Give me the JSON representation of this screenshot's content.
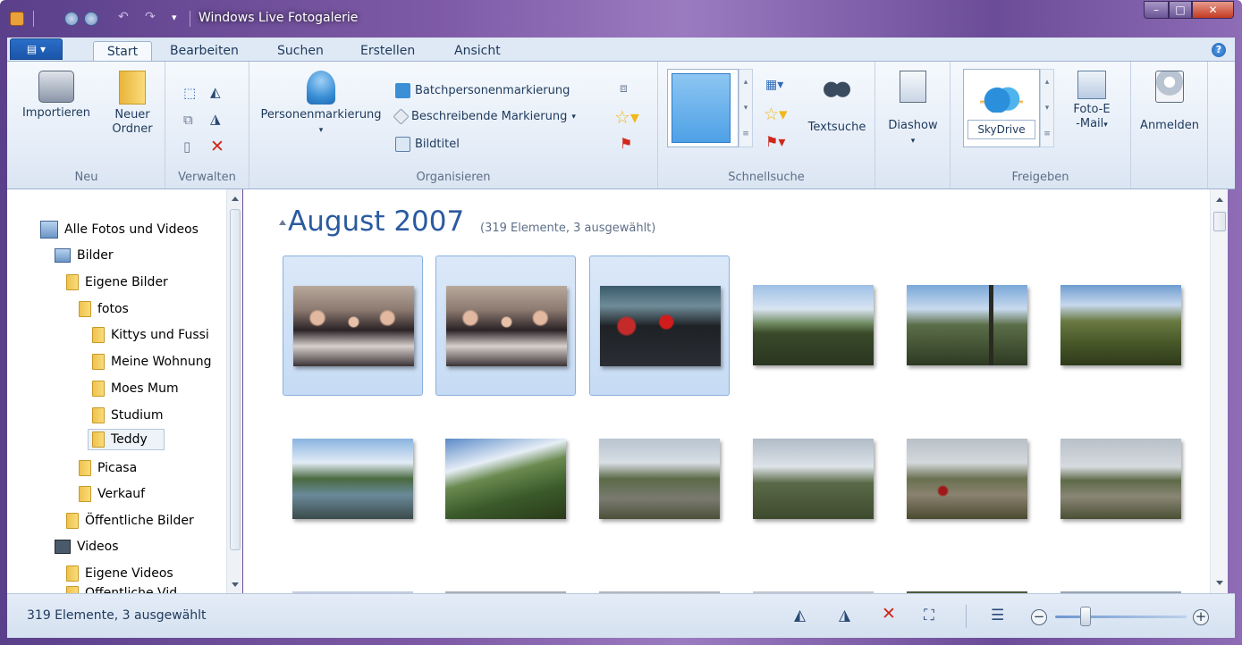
{
  "window": {
    "title": "Windows Live Fotogalerie",
    "min": "–",
    "max": "□",
    "close": "✕"
  },
  "ribbon": {
    "tabs": [
      "Start",
      "Bearbeiten",
      "Suchen",
      "Erstellen",
      "Ansicht"
    ],
    "help": "?",
    "groups": {
      "neu": {
        "label": "Neu",
        "importieren": "Importieren",
        "neuer_ordner_1": "Neuer",
        "neuer_ordner_2": "Ordner"
      },
      "verwalten": {
        "label": "Verwalten"
      },
      "organisieren": {
        "label": "Organisieren",
        "personen": "Personenmarkierung",
        "batch": "Batchpersonenmarkierung",
        "beschreibend": "Beschreibende Markierung",
        "bildtitel": "Bildtitel"
      },
      "schnellsuche": {
        "label": "Schnellsuche",
        "textsuche": "Textsuche"
      },
      "diashow": {
        "label": "Diashow"
      },
      "freigeben": {
        "label": "Freigeben",
        "skydrive": "SkyDrive",
        "foto_email_1": "Foto-E",
        "foto_email_2": "-Mail"
      },
      "anmelden": {
        "label": "Anmelden"
      }
    }
  },
  "nav": {
    "items": [
      {
        "label": "Alle Fotos und Videos",
        "type": "gallery"
      },
      {
        "label": "Bilder",
        "type": "pictures"
      },
      {
        "label": "Eigene Bilder",
        "type": "folder"
      },
      {
        "label": "fotos",
        "type": "folder"
      },
      {
        "label": "Kittys und Fussi",
        "type": "folder"
      },
      {
        "label": "Meine Wohnung",
        "type": "folder"
      },
      {
        "label": "Moes Mum",
        "type": "folder"
      },
      {
        "label": "Studium",
        "type": "folder"
      },
      {
        "label": "Teddy",
        "type": "folder",
        "selected": true
      },
      {
        "label": "Picasa",
        "type": "folder"
      },
      {
        "label": "Verkauf",
        "type": "folder"
      },
      {
        "label": "Öffentliche Bilder",
        "type": "folder"
      },
      {
        "label": "Videos",
        "type": "videos"
      },
      {
        "label": "Eigene Videos",
        "type": "folder"
      },
      {
        "label": "Öffentliche Vid",
        "type": "folder"
      }
    ]
  },
  "main": {
    "heading": "August 2007",
    "subheading": "(319 Elemente, 3 ausgewählt)",
    "photos": [
      {
        "kind": "people",
        "selected": true
      },
      {
        "kind": "people",
        "selected": true
      },
      {
        "kind": "people",
        "selected": true
      },
      {
        "kind": "landscape",
        "selected": false
      },
      {
        "kind": "landscape",
        "selected": false
      },
      {
        "kind": "landscape",
        "selected": false
      },
      {
        "kind": "landscape",
        "selected": false
      },
      {
        "kind": "landscape",
        "selected": false
      },
      {
        "kind": "landscape",
        "selected": false
      },
      {
        "kind": "landscape",
        "selected": false
      },
      {
        "kind": "landscape",
        "selected": false
      },
      {
        "kind": "landscape",
        "selected": false
      }
    ]
  },
  "status": {
    "text": "319 Elemente, 3 ausgewählt",
    "zoom_minus": "−",
    "zoom_plus": "+",
    "zoom_level": 0.23
  }
}
